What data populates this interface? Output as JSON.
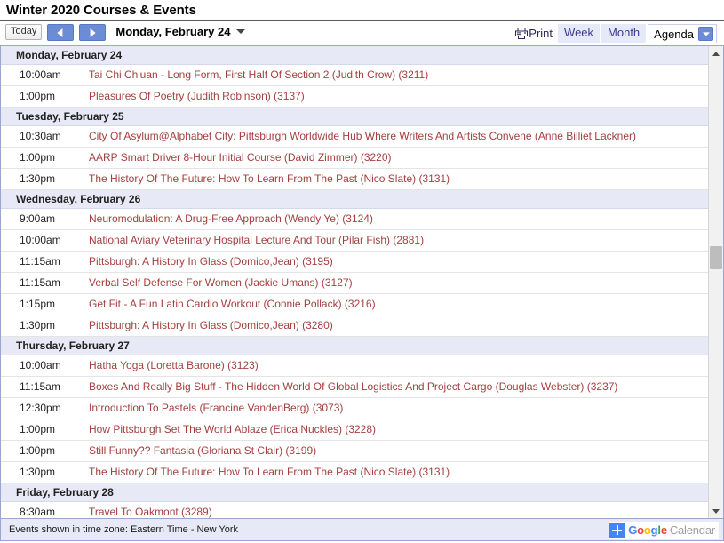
{
  "window": {
    "title": "Winter 2020 Courses & Events"
  },
  "toolbar": {
    "today_label": "Today",
    "prev_label": "Previous period",
    "next_label": "Next period",
    "date_range": "Monday, February 24",
    "print_label": "Print",
    "views": [
      {
        "label": "Week",
        "active": false
      },
      {
        "label": "Month",
        "active": false
      },
      {
        "label": "Agenda",
        "active": true
      }
    ]
  },
  "agenda": {
    "days": [
      {
        "header": "Monday, February 24",
        "events": [
          {
            "time": "10:00am",
            "title": "Tai Chi Ch'uan - Long Form, First Half Of Section 2 (Judith Crow) (3211)"
          },
          {
            "time": "1:00pm",
            "title": "Pleasures Of Poetry (Judith Robinson) (3137)"
          }
        ]
      },
      {
        "header": "Tuesday, February 25",
        "events": [
          {
            "time": "10:30am",
            "title": "City Of Asylum@Alphabet City: Pittsburgh Worldwide Hub Where Writers And Artists Convene (Anne Billiet Lackner)"
          },
          {
            "time": "1:00pm",
            "title": "AARP Smart Driver 8-Hour Initial Course (David Zimmer) (3220)"
          },
          {
            "time": "1:30pm",
            "title": "The History Of The Future: How To Learn From The Past (Nico Slate) (3131)"
          }
        ]
      },
      {
        "header": "Wednesday, February 26",
        "events": [
          {
            "time": "9:00am",
            "title": "Neuromodulation: A Drug-Free Approach (Wendy Ye) (3124)"
          },
          {
            "time": "10:00am",
            "title": "National Aviary Veterinary Hospital Lecture And Tour (Pilar Fish) (2881)"
          },
          {
            "time": "11:15am",
            "title": "Pittsburgh: A History In Glass (Domico,Jean) (3195)"
          },
          {
            "time": "11:15am",
            "title": "Verbal Self Defense For Women (Jackie Umans) (3127)"
          },
          {
            "time": "1:15pm",
            "title": "Get Fit - A Fun Latin Cardio Workout (Connie Pollack) (3216)"
          },
          {
            "time": "1:30pm",
            "title": "Pittsburgh: A History In Glass (Domico,Jean) (3280)"
          }
        ]
      },
      {
        "header": "Thursday, February 27",
        "events": [
          {
            "time": "10:00am",
            "title": "Hatha Yoga (Loretta Barone) (3123)"
          },
          {
            "time": "11:15am",
            "title": "Boxes And Really Big Stuff - The Hidden World Of Global Logistics And Project Cargo (Douglas Webster) (3237)"
          },
          {
            "time": "12:30pm",
            "title": "Introduction To Pastels (Francine VandenBerg) (3073)"
          },
          {
            "time": "1:00pm",
            "title": "How Pittsburgh Set The World Ablaze (Erica Nuckles) (3228)"
          },
          {
            "time": "1:00pm",
            "title": "Still Funny?? Fantasia (Gloriana St Clair) (3199)"
          },
          {
            "time": "1:30pm",
            "title": "The History Of The Future: How To Learn From The Past (Nico Slate) (3131)"
          }
        ]
      },
      {
        "header": "Friday, February 28",
        "events": [
          {
            "time": "8:30am",
            "title": "Travel To Oakmont (3289)"
          }
        ]
      }
    ]
  },
  "footer": {
    "timezone_text": "Events shown in time zone: Eastern Time - New York",
    "brand": {
      "g1": "G",
      "o1": "o",
      "o2": "o",
      "g2": "g",
      "l": "l",
      "e": "e",
      "calendar": "Calendar"
    }
  },
  "colors": {
    "event_title": "#a53f3f",
    "day_header_bg": "#e7eaf6",
    "accent_blue": "#6c8cd5",
    "google_blue": "#4285f4",
    "google_red": "#ea4335",
    "google_yellow": "#fbbc05",
    "google_green": "#34a853"
  }
}
